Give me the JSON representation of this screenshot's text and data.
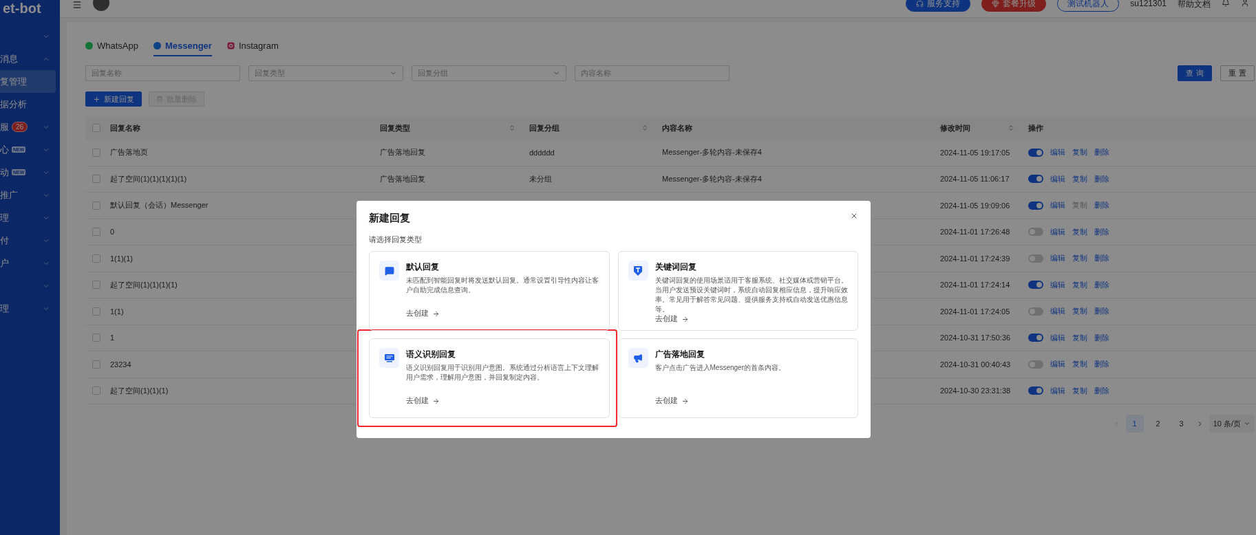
{
  "sidebar": {
    "logo": "et-bot",
    "items": [
      {
        "expanded": false
      },
      {
        "label": "消息",
        "expanded": true,
        "children": [
          {
            "label": "复管理",
            "selected": true
          },
          {
            "label": "据分析",
            "selected": false
          }
        ]
      },
      {
        "label": "服",
        "badge": "26",
        "expanded": false
      },
      {
        "label": "心",
        "tag": "NEW",
        "expanded": false
      },
      {
        "label": "动",
        "tag": "NEW",
        "expanded": false
      },
      {
        "label": "推广",
        "expanded": false
      },
      {
        "label": "理",
        "expanded": false
      },
      {
        "label": "付",
        "expanded": false
      },
      {
        "label": "户",
        "expanded": false
      },
      {
        "expanded": false
      },
      {
        "label": "理",
        "expanded": false
      }
    ]
  },
  "header": {
    "buttons": [
      {
        "kind": "support",
        "label": "服务支持"
      },
      {
        "kind": "upgrade",
        "label": "套餐升级"
      },
      {
        "kind": "outline",
        "label": "测试机器人"
      }
    ],
    "user": "su121301",
    "help": "帮助文档"
  },
  "tabs": [
    {
      "kind": "whatsapp",
      "label": "WhatsApp",
      "selected": false
    },
    {
      "kind": "messenger",
      "label": "Messenger",
      "selected": true
    },
    {
      "kind": "instagram",
      "label": "Instagram",
      "selected": false
    }
  ],
  "filters": [
    {
      "kind": "input",
      "placeholder": "回复名称"
    },
    {
      "kind": "select",
      "placeholder": "回复类型"
    },
    {
      "kind": "select",
      "placeholder": "回复分组"
    },
    {
      "kind": "input",
      "placeholder": "内容名称"
    }
  ],
  "filter_buttons": [
    {
      "kind": "primary",
      "label": "查 询"
    },
    {
      "kind": "default",
      "label": "重 置"
    }
  ],
  "actions": [
    {
      "label": "新建回复",
      "disabled": false
    },
    {
      "label": "批量删除",
      "disabled": true
    }
  ],
  "table": {
    "select_all": false,
    "columns": [
      {
        "label": "回复名称",
        "sortable": false
      },
      {
        "label": "回复类型",
        "sortable": true
      },
      {
        "label": "回复分组",
        "sortable": true
      },
      {
        "label": "内容名称",
        "sortable": false
      },
      {
        "label": "修改时间",
        "sortable": true
      },
      {
        "label": "操作",
        "sortable": false
      }
    ],
    "rows": [
      {
        "checked": false,
        "name": "广告落地页",
        "type": "广告落地回复",
        "group": "dddddd",
        "content": "Messenger-多轮内容-未保存4",
        "time": "2024-11-05 19:17:05",
        "enabled": true,
        "ops": [
          {
            "label": "编辑",
            "disabled": false
          },
          {
            "label": "复制",
            "disabled": false
          },
          {
            "label": "删除",
            "disabled": false
          }
        ]
      },
      {
        "checked": false,
        "name": "起了空间(1)(1)(1)(1)(1)",
        "type": "广告落地回复",
        "group": "未分组",
        "content": "Messenger-多轮内容-未保存4",
        "time": "2024-11-05 11:06:17",
        "enabled": true,
        "ops": [
          {
            "label": "编辑",
            "disabled": false
          },
          {
            "label": "复制",
            "disabled": false
          },
          {
            "label": "删除",
            "disabled": false
          }
        ]
      },
      {
        "checked": false,
        "name": "默认回复（会话）Messenger",
        "time": "2024-11-05 19:09:06",
        "enabled": true,
        "ops": [
          {
            "label": "编辑",
            "disabled": false
          },
          {
            "label": "复制",
            "disabled": true
          },
          {
            "label": "删除",
            "disabled": false
          }
        ]
      },
      {
        "checked": false,
        "name": "0",
        "time": "2024-11-01 17:26:48",
        "enabled": false,
        "ops": [
          {
            "label": "编辑",
            "disabled": false
          },
          {
            "label": "复制",
            "disabled": false
          },
          {
            "label": "删除",
            "disabled": false
          }
        ]
      },
      {
        "checked": false,
        "name": "1(1)(1)",
        "time": "2024-11-01 17:24:39",
        "enabled": false,
        "ops": [
          {
            "label": "编辑",
            "disabled": false
          },
          {
            "label": "复制",
            "disabled": false
          },
          {
            "label": "删除",
            "disabled": false
          }
        ]
      },
      {
        "checked": false,
        "name": "起了空间(1)(1)(1)(1)",
        "time": "2024-11-01 17:24:14",
        "enabled": true,
        "ops": [
          {
            "label": "编辑",
            "disabled": false
          },
          {
            "label": "复制",
            "disabled": false
          },
          {
            "label": "删除",
            "disabled": false
          }
        ]
      },
      {
        "checked": false,
        "name": "1(1)",
        "time": "2024-11-01 17:24:05",
        "enabled": false,
        "ops": [
          {
            "label": "编辑",
            "disabled": false
          },
          {
            "label": "复制",
            "disabled": false
          },
          {
            "label": "删除",
            "disabled": false
          }
        ]
      },
      {
        "checked": false,
        "name": "1",
        "time": "2024-10-31 17:50:36",
        "enabled": true,
        "ops": [
          {
            "label": "编辑",
            "disabled": false
          },
          {
            "label": "复制",
            "disabled": false
          },
          {
            "label": "删除",
            "disabled": false
          }
        ]
      },
      {
        "checked": false,
        "name": "23234",
        "time": "2024-10-31 00:40:43",
        "enabled": false,
        "ops": [
          {
            "label": "编辑",
            "disabled": false
          },
          {
            "label": "复制",
            "disabled": false
          },
          {
            "label": "删除",
            "disabled": false
          }
        ]
      },
      {
        "checked": false,
        "name": "起了空间(1)(1)(1)",
        "time": "2024-10-30 23:31:38",
        "enabled": true,
        "ops": [
          {
            "label": "编辑",
            "disabled": false
          },
          {
            "label": "复制",
            "disabled": false
          },
          {
            "label": "删除",
            "disabled": false
          }
        ]
      }
    ]
  },
  "pagination": {
    "pages": [
      {
        "label": "1",
        "selected": true
      },
      {
        "label": "2",
        "selected": false
      },
      {
        "label": "3",
        "selected": false
      }
    ],
    "page_size": "10 条/页"
  },
  "modal": {
    "title": "新建回复",
    "subtitle": "请选择回复类型",
    "cards": [
      {
        "kind": "chat",
        "title": "默认回复",
        "description": "未匹配到智能回复时将发送默认回复。通常设置引导性内容让客户自助完成信息查询。",
        "link": "去创建",
        "highlighted": false
      },
      {
        "kind": "keyword",
        "title": "关键词回复",
        "description": "关键词回复的使用场景适用于客服系统、社交媒体或营销平台。当用户发送预设关键词时，系统自动回复相应信息，提升响应效率。常见用于解答常见问题、提供服务支持或自动发送优惠信息等。",
        "link": "去创建",
        "highlighted": false
      },
      {
        "kind": "nlp",
        "title": "语义识别回复",
        "description": "语义识别回复用于识别用户意图。系统通过分析语言上下文理解用户需求，理解用户意图，并回复制定内容。",
        "link": "去创建",
        "highlighted": true
      },
      {
        "kind": "ad",
        "title": "广告落地回复",
        "description": "客户点击广告进入Messenger的首条内容。",
        "link": "去创建",
        "highlighted": false
      }
    ]
  }
}
